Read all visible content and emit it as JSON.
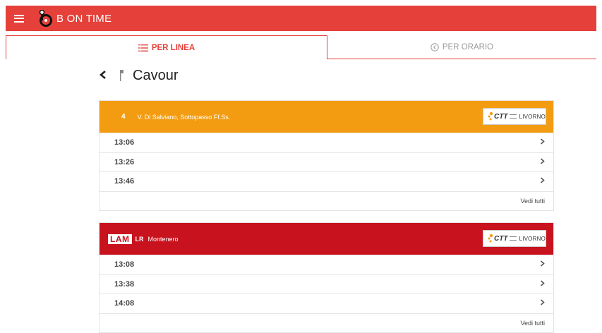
{
  "app": {
    "title": "B ON TIME",
    "brand_color": "#e5413a"
  },
  "tabs": [
    {
      "label": "PER LINEA",
      "active": true,
      "icon": "list-icon"
    },
    {
      "label": "PER ORARIO",
      "active": false,
      "icon": "clock-icon"
    }
  ],
  "stop": {
    "name": "Cavour",
    "back_icon": "chevron-left-icon",
    "icon": "bus-stop-icon"
  },
  "cards": [
    {
      "route_number": "4",
      "destination": "V. Di Salviano, Sottopasso Ff.Ss.",
      "header_color": "#f39c12",
      "operator": {
        "name": "CTT",
        "city": "LIVORNO"
      },
      "departures": [
        "13:06",
        "13:26",
        "13:46"
      ],
      "see_all": "Vedi tutti"
    },
    {
      "badge": "LAM",
      "route_number": "LR",
      "destination": "Montenero",
      "header_color": "#c8131f",
      "operator": {
        "name": "CTT",
        "city": "LIVORNO"
      },
      "departures": [
        "13:08",
        "13:38",
        "14:08"
      ],
      "see_all": "Vedi tutti"
    }
  ]
}
